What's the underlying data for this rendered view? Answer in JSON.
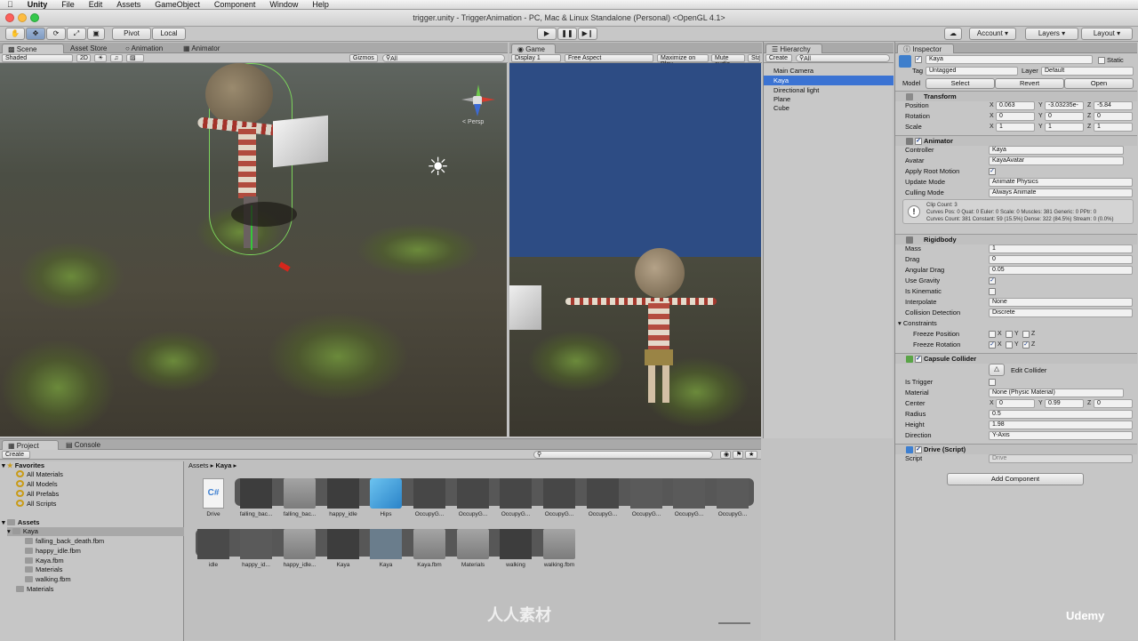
{
  "menubar": {
    "app": "Unity",
    "items": [
      "File",
      "Edit",
      "Assets",
      "GameObject",
      "Component",
      "Window",
      "Help"
    ]
  },
  "window_title": "trigger.unity - TriggerAnimation - PC, Mac & Linux Standalone (Personal) <OpenGL 4.1>",
  "toolbar": {
    "pivot": "Pivot",
    "local": "Local",
    "account": "Account",
    "layers": "Layers",
    "layout": "Layout"
  },
  "scene": {
    "tabs": [
      "Scene",
      "Asset Store",
      "Animation",
      "Animator"
    ],
    "shaded": "Shaded",
    "mode2d": "2D",
    "gizmos": "Gizmos",
    "search": "All",
    "persp": "< Persp"
  },
  "game": {
    "tab": "Game",
    "display": "Display 1",
    "aspect": "Free Aspect",
    "maximize": "Maximize on Play",
    "mute": "Mute audio",
    "stats": "Stat"
  },
  "hierarchy": {
    "tab": "Hierarchy",
    "create": "Create",
    "search": "All",
    "items": [
      "Main Camera",
      "Kaya",
      "Directional light",
      "Plane",
      "Cube"
    ],
    "selected": 1
  },
  "inspector": {
    "tab": "Inspector",
    "name": "Kaya",
    "static": "Static",
    "tag_label": "Tag",
    "tag": "Untagged",
    "layer_label": "Layer",
    "layer": "Default",
    "model_label": "Model",
    "select": "Select",
    "revert": "Revert",
    "open": "Open",
    "transform": {
      "title": "Transform",
      "position": {
        "label": "Position",
        "x": "0.063",
        "y": "-3.03235e-",
        "z": "-5.84"
      },
      "rotation": {
        "label": "Rotation",
        "x": "0",
        "y": "0",
        "z": "0"
      },
      "scale": {
        "label": "Scale",
        "x": "1",
        "y": "1",
        "z": "1"
      }
    },
    "animator": {
      "title": "Animator",
      "controller_label": "Controller",
      "controller": "Kaya",
      "avatar_label": "Avatar",
      "avatar": "KayaAvatar",
      "root_motion": "Apply Root Motion",
      "update_label": "Update Mode",
      "update": "Animate Physics",
      "culling_label": "Culling Mode",
      "culling": "Always Animate",
      "info1": "Clip Count: 3",
      "info2": "Curves Pos: 0 Quat: 0 Euler: 0 Scale: 0 Muscles: 381 Generic: 0 PPtr: 0",
      "info3": "Curves Count: 381 Constant: 59 (15.5%) Dense: 322 (84.5%) Stream: 0 (0.0%)"
    },
    "rigidbody": {
      "title": "Rigidbody",
      "mass_label": "Mass",
      "mass": "1",
      "drag_label": "Drag",
      "drag": "0",
      "angular_label": "Angular Drag",
      "angular": "0.05",
      "gravity": "Use Gravity",
      "kinematic": "Is Kinematic",
      "interp_label": "Interpolate",
      "interp": "None",
      "collision_label": "Collision Detection",
      "collision": "Discrete",
      "constraints": "Constraints",
      "freeze_pos": "Freeze Position",
      "freeze_rot": "Freeze Rotation",
      "x": "X",
      "y": "Y",
      "z": "Z"
    },
    "capsule": {
      "title": "Capsule Collider",
      "edit": "Edit Collider",
      "trigger": "Is Trigger",
      "material_label": "Material",
      "material": "None (Physic Material)",
      "center_label": "Center",
      "cx": "0",
      "cy": "0.99",
      "cz": "0",
      "radius_label": "Radius",
      "radius": "0.5",
      "height_label": "Height",
      "height": "1.98",
      "direction_label": "Direction",
      "direction": "Y-Axis"
    },
    "drive": {
      "title": "Drive (Script)",
      "script_label": "Script",
      "script": "Drive"
    },
    "add_component": "Add Component"
  },
  "project": {
    "tabs": [
      "Project",
      "Console"
    ],
    "create": "Create",
    "favorites": "Favorites",
    "fav_items": [
      "All Materials",
      "All Models",
      "All Prefabs",
      "All Scripts"
    ],
    "assets": "Assets",
    "kaya": "Kaya",
    "kaya_items": [
      "falling_back_death.fbm",
      "happy_idle.fbm",
      "Kaya.fbm",
      "Materials",
      "walking.fbm"
    ],
    "materials": "Materials",
    "breadcrumb": [
      "Assets",
      "Kaya"
    ],
    "row1": [
      "Drive",
      "falling_bac...",
      "falling_bac...",
      "happy_idle",
      "Hips",
      "OccupyG...",
      "OccupyG...",
      "OccupyG...",
      "OccupyG...",
      "OccupyG...",
      "OccupyG...",
      "OccupyG...",
      "OccupyG..."
    ],
    "row2": [
      "idle",
      "happy_id...",
      "happy_idle...",
      "Kaya",
      "Kaya",
      "Kaya.fbm",
      "Materials",
      "walking",
      "walking.fbm"
    ]
  },
  "watermark": {
    "brand": "人人素材",
    "udemy": "Udemy"
  }
}
